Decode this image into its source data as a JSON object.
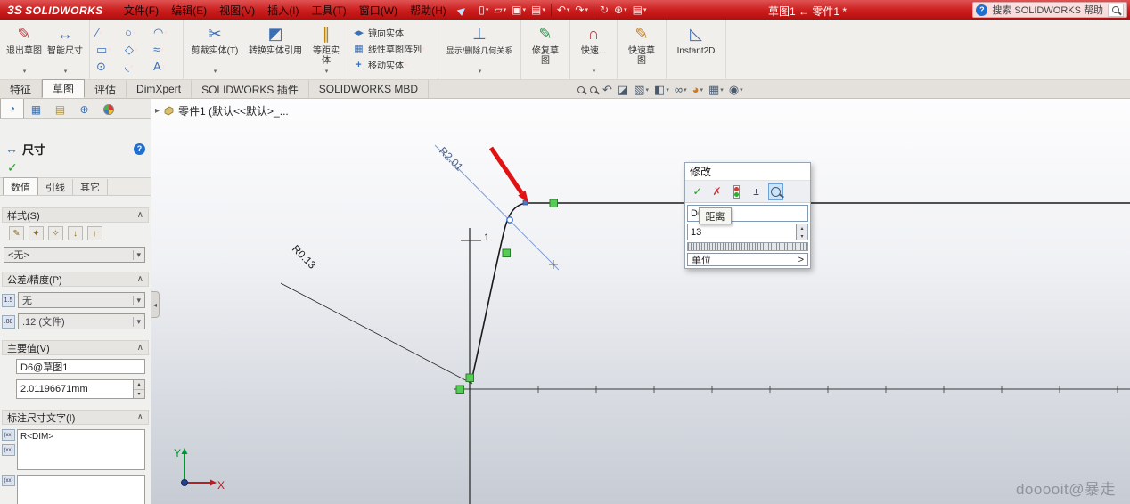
{
  "titlebar": {
    "logo_mark": "3S",
    "logo_name": "SOLIDWORKS",
    "menus": [
      "文件(F)",
      "编辑(E)",
      "视图(V)",
      "插入(I)",
      "工具(T)",
      "窗口(W)",
      "帮助(H)"
    ],
    "doc_title": "草图1 ← 零件1 *",
    "search_text": "搜索 SOLIDWORKS 帮助"
  },
  "ribbon": {
    "exit_sketch": "退出草图",
    "smart_dimension": "智能尺寸",
    "trim": "剪裁实体(T)",
    "convert": "转换实体引用",
    "offset": "等距实\n体",
    "mirror": "镜向实体",
    "linear_pattern": "线性草图阵列",
    "move": "移动实体",
    "relations": "显示/删除几何关系",
    "repair": "修复草\n图",
    "quick_snaps": "快速...",
    "rapid_sketch": "快速草\n图",
    "instant2d": "Instant2D"
  },
  "tabs": {
    "items": [
      "特征",
      "草图",
      "评估",
      "DimXpert",
      "SOLIDWORKS 插件",
      "SOLIDWORKS MBD"
    ]
  },
  "panel": {
    "title": "尺寸",
    "value_tabs": [
      "数值",
      "引线",
      "其它"
    ],
    "style": {
      "label": "样式(S)",
      "selected": "<无>"
    },
    "tolerance": {
      "label": "公差/精度(P)",
      "tol_icon": "1.5",
      "tol_value": "无",
      "prec_icon": ".88",
      "prec_value": ".12 (文件)"
    },
    "primary": {
      "label": "主要值(V)",
      "name": "D6@草图1",
      "value": "2.01196671mm"
    },
    "dim_text": {
      "label": "标注尺寸文字(I)",
      "icon": "(xx)",
      "text": "R<DIM>"
    }
  },
  "tree": {
    "root": "零件1 (默认<<默认>_..."
  },
  "modify": {
    "title": "修改",
    "name_value": "D6",
    "tooltip": "距离",
    "value": "13",
    "units_label": "单位",
    "units_arrow": ">"
  },
  "sketch": {
    "dim_r2": "R2.01",
    "dim_r0": "R0.13",
    "dim_1": "1",
    "axis_x": "X",
    "axis_y": "Y"
  },
  "watermark": "dooooit@暴走",
  "icons": {
    "pin": "▶",
    "dropdown": "▾",
    "qmark": "?",
    "new": "▯",
    "open": "▱",
    "save": "▣",
    "print": "▤",
    "undo": "↶",
    "redo": "↷",
    "rebuild": "↻",
    "options": "⊛",
    "list": "▤",
    "exit_sketch": "✎",
    "smart_dim": "↔",
    "line": "∕",
    "circle": "○",
    "arc": "◠",
    "rect": "▭",
    "poly": "◇",
    "spline": "≈",
    "point": "⊙",
    "fillet": "◟",
    "text_tool": "A",
    "trim": "✂",
    "convert": "◩",
    "offset": "∥",
    "mirror": "◂▸",
    "pattern": "▦",
    "move": "+",
    "relations": "⊥",
    "repair": "✎",
    "snaps": "∩",
    "rapid": "✎",
    "instant2d": "◺",
    "hu_prev": "↶",
    "hu_section": "◪",
    "hu_orient": "▧",
    "hu_style": "◧",
    "hu_hide": "∞",
    "hu_appearance": "◕",
    "hu_scene": "▦",
    "hu_settings": "◉",
    "pm_tab1": "◔",
    "pm_tab2": "▦",
    "pm_tab3": "▤",
    "pm_tab4": "⊕",
    "dim_header": "↔",
    "check": "✓",
    "cross": "✗",
    "plusminus": "±",
    "up": "▴",
    "down": "▾",
    "collapse": "∧",
    "splitter": "◂",
    "tree_expand": "▸",
    "style1": "✎",
    "style2": "✦",
    "style3": "✧",
    "style4": "↓",
    "style5": "↑"
  }
}
